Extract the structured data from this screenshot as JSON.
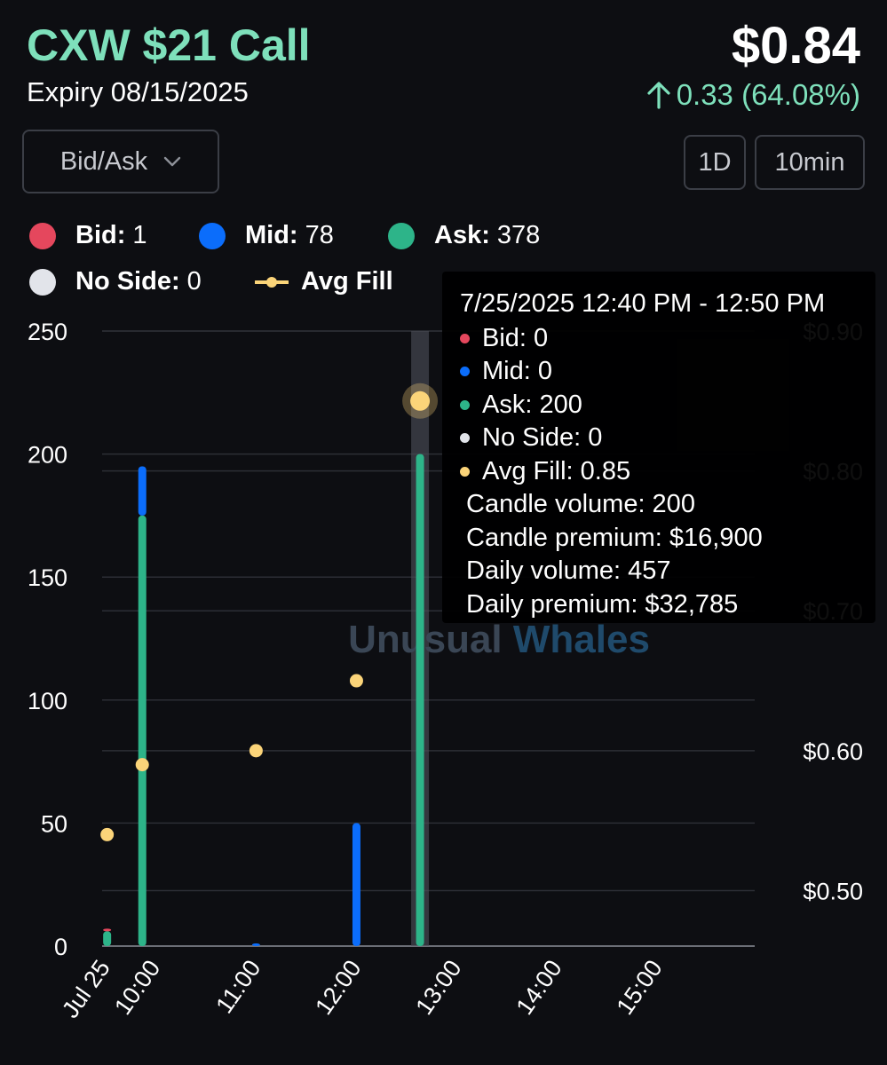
{
  "header": {
    "title": "CXW $21 Call",
    "expiry": "Expiry 08/15/2025",
    "price": "$0.84",
    "change": "0.33 (64.08%)",
    "change_direction": "up"
  },
  "controls": {
    "dropdown_value": "Bid/Ask",
    "timeframe_buttons": [
      "1D",
      "10min"
    ]
  },
  "legend": {
    "bid": {
      "label": "Bid:",
      "value": "1",
      "color": "#e5475d"
    },
    "mid": {
      "label": "Mid:",
      "value": "78",
      "color": "#0b6dfb"
    },
    "ask": {
      "label": "Ask:",
      "value": "378",
      "color": "#2db489"
    },
    "no_side": {
      "label": "No Side:",
      "value": "0",
      "color": "#e2e4ea"
    },
    "avg_fill": {
      "label": "Avg Fill",
      "color": "#fbd479"
    }
  },
  "watermark": {
    "part1": "Unusual",
    "part2": "Whales"
  },
  "tooltip": {
    "date": "7/25/2025 12:40 PM - 12:50 PM",
    "bid": "Bid: 0",
    "mid": "Mid: 0",
    "ask": "Ask: 200",
    "no_side": "No Side: 0",
    "avg_fill": "Avg Fill: 0.85",
    "candle_volume": "Candle volume: 200",
    "candle_premium": "Candle premium: $16,900",
    "daily_volume": "Daily volume: 457",
    "daily_premium": "Daily premium: $32,785"
  },
  "chart_data": {
    "type": "bar",
    "stacked": true,
    "x_tick_labels": [
      "Jul 25",
      "10:00",
      "11:00",
      "12:00",
      "13:00",
      "14:00",
      "15:00"
    ],
    "x_range_minutes": [
      570,
      960
    ],
    "y_left": {
      "ticks": [
        "250",
        "200",
        "150",
        "100",
        "50",
        "0"
      ],
      "range": [
        0,
        250
      ]
    },
    "y_right": {
      "ticks": [
        "$0.90",
        "$0.80",
        "$0.70",
        "$0.60",
        "$0.50"
      ],
      "range": [
        0.48,
        0.9
      ]
    },
    "grid": true,
    "highlight_minutes": 760,
    "bars": [
      {
        "minutes": 573,
        "bid": 1,
        "mid": 0,
        "ask": 6
      },
      {
        "minutes": 594,
        "bid": 0,
        "mid": 20,
        "ask": 175
      },
      {
        "minutes": 662,
        "bid": 0,
        "mid": 1,
        "ask": 0
      },
      {
        "minutes": 722,
        "bid": 0,
        "mid": 50,
        "ask": 0
      },
      {
        "minutes": 760,
        "bid": 0,
        "mid": 0,
        "ask": 200
      }
    ],
    "avg_fill": [
      {
        "minutes": 573,
        "value": 0.54
      },
      {
        "minutes": 594,
        "value": 0.59
      },
      {
        "minutes": 662,
        "value": 0.6
      },
      {
        "minutes": 722,
        "value": 0.65
      },
      {
        "minutes": 760,
        "value": 0.85
      }
    ]
  }
}
